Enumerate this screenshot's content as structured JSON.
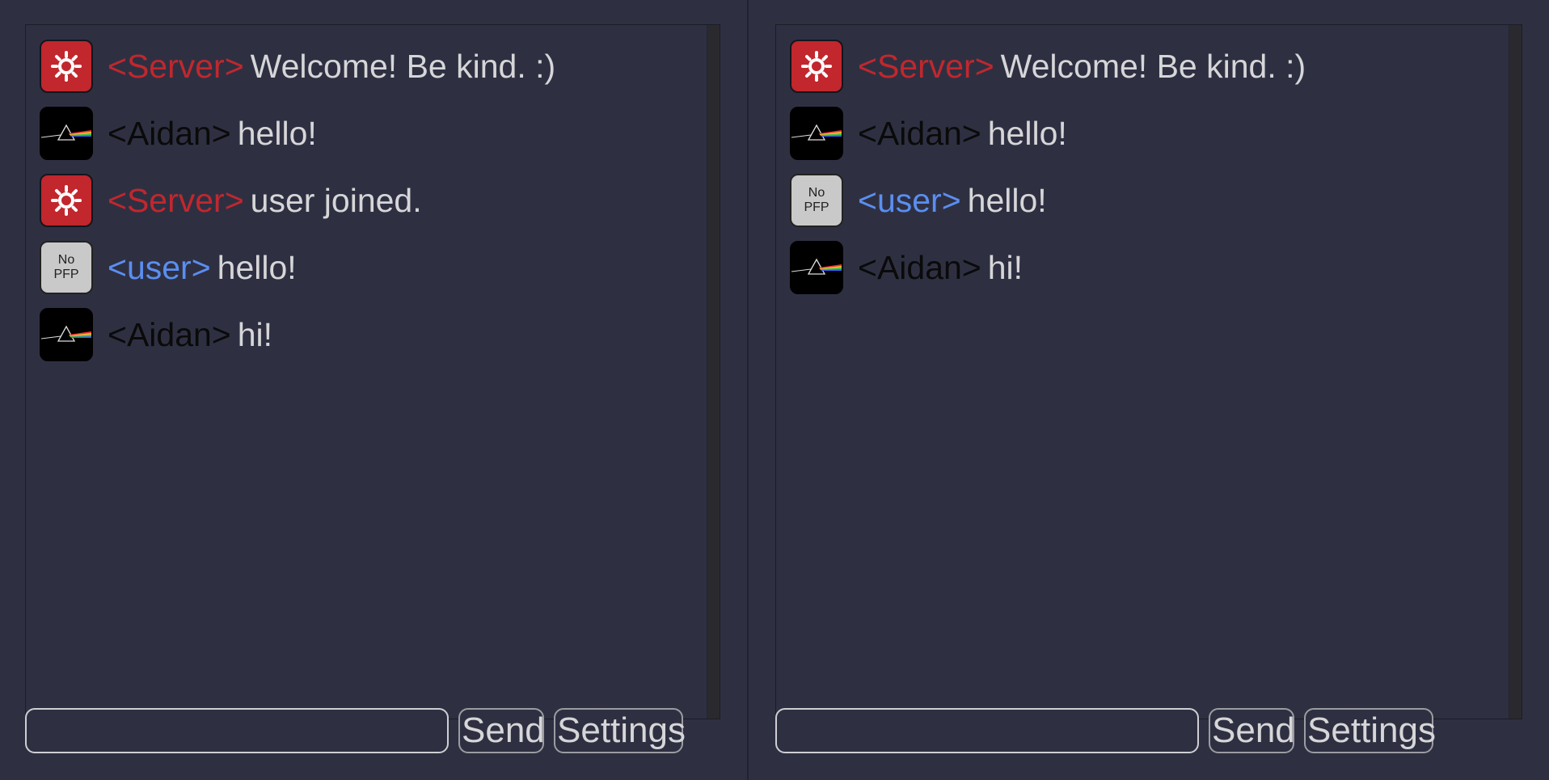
{
  "colors": {
    "server": "#c1272d",
    "aidan": "#0a0a0a",
    "user": "#5b8ef0",
    "text": "#d6d6d8"
  },
  "panels": [
    {
      "messages": [
        {
          "avatar": "server-gear-icon",
          "name": "<Server>",
          "name_color": "server",
          "text": "Welcome! Be kind. :)"
        },
        {
          "avatar": "prism-icon",
          "name": "<Aidan>",
          "name_color": "aidan",
          "text": "hello!"
        },
        {
          "avatar": "server-gear-icon",
          "name": "<Server>",
          "name_color": "server",
          "text": "user joined."
        },
        {
          "avatar": "no-pfp",
          "avatar_text": [
            "No",
            "PFP"
          ],
          "name": "<user>",
          "name_color": "user",
          "text": "hello!"
        },
        {
          "avatar": "prism-icon",
          "name": "<Aidan>",
          "name_color": "aidan",
          "text": "hi!"
        }
      ],
      "input": {
        "value": "",
        "placeholder": ""
      },
      "send_label": "Send",
      "settings_label": "Settings"
    },
    {
      "messages": [
        {
          "avatar": "server-gear-icon",
          "name": "<Server>",
          "name_color": "server",
          "text": "Welcome! Be kind. :)"
        },
        {
          "avatar": "prism-icon",
          "name": "<Aidan>",
          "name_color": "aidan",
          "text": "hello!"
        },
        {
          "avatar": "no-pfp",
          "avatar_text": [
            "No",
            "PFP"
          ],
          "name": "<user>",
          "name_color": "user",
          "text": "hello!"
        },
        {
          "avatar": "prism-icon",
          "name": "<Aidan>",
          "name_color": "aidan",
          "text": "hi!"
        }
      ],
      "input": {
        "value": "",
        "placeholder": ""
      },
      "send_label": "Send",
      "settings_label": "Settings"
    }
  ]
}
